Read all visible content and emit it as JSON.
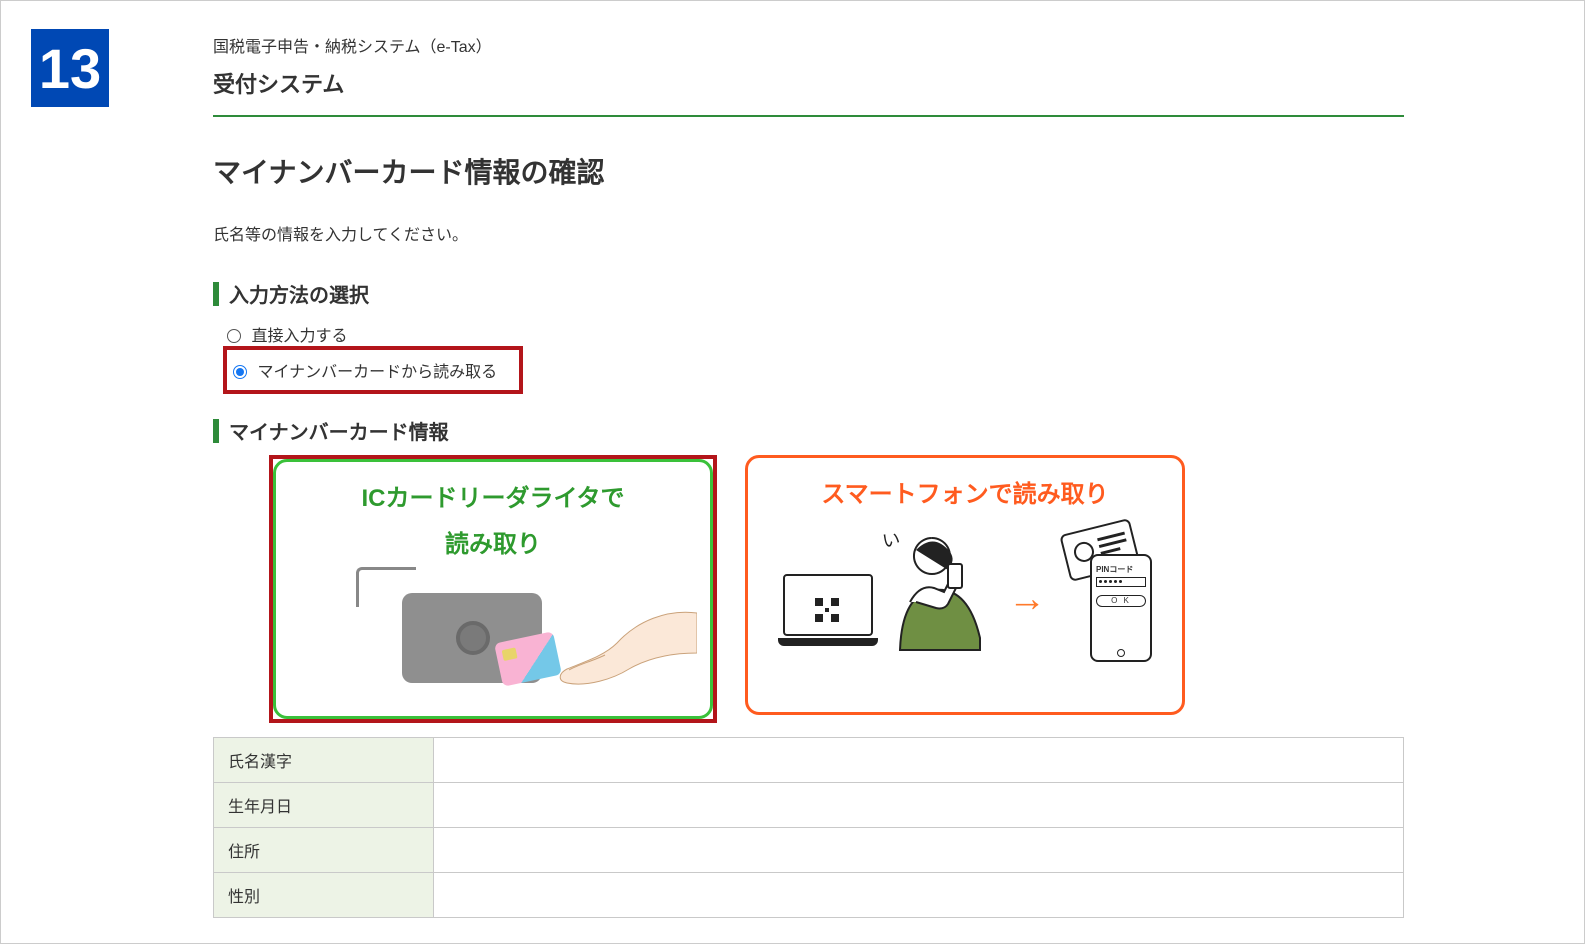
{
  "step_number": "13",
  "header": {
    "system_line": "国税電子申告・納税システム（e-Tax）",
    "system_title": "受付システム"
  },
  "page_title": "マイナンバーカード情報の確認",
  "description": "氏名等の情報を入力してください。",
  "section_input_method": {
    "heading": "入力方法の選択",
    "option1_label": "直接入力する",
    "option2_label": "マイナンバーカードから読み取る"
  },
  "section_card_info": {
    "heading": "マイナンバーカード情報"
  },
  "read_options": {
    "ic": {
      "line1": "ICカードリーダライタで",
      "line2": "読み取り"
    },
    "sp": {
      "title": "スマートフォンで読み取り",
      "pin_label": "PINコード",
      "ok_label": "O K"
    }
  },
  "table": {
    "row1": "氏名漢字",
    "row2": "生年月日",
    "row3": "住所",
    "row4": "性別"
  }
}
